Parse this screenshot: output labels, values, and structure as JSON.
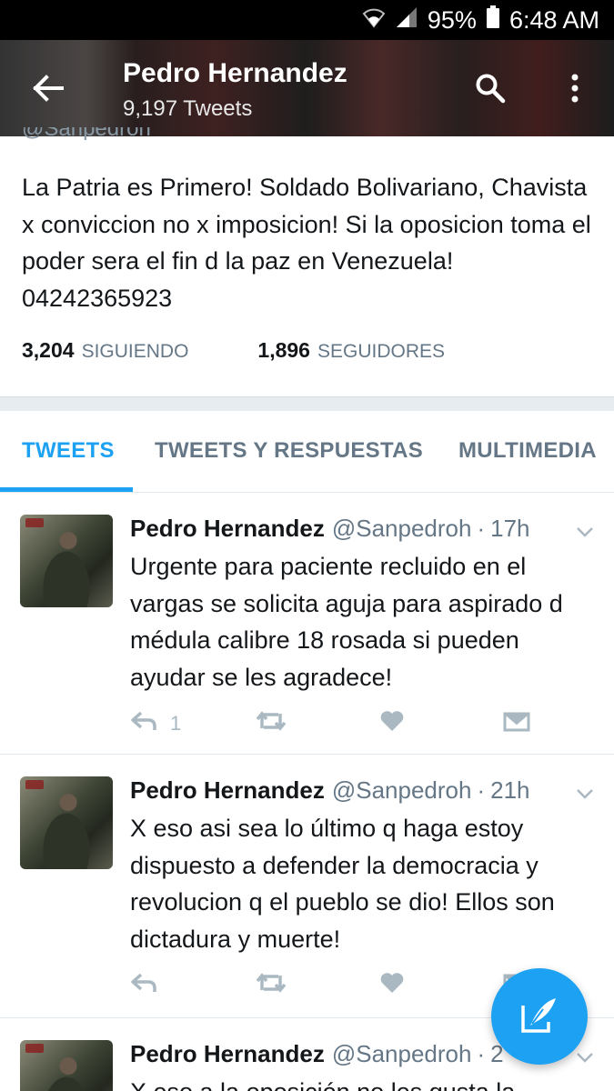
{
  "status_bar": {
    "battery": "95%",
    "time": "6:48 AM",
    "icons": [
      "wifi-icon",
      "signal-icon",
      "battery-icon"
    ]
  },
  "header": {
    "name": "Pedro Hernandez",
    "tweet_count": "9,197 Tweets",
    "icons": [
      "back-arrow-icon",
      "search-icon",
      "more-vertical-icon"
    ]
  },
  "profile": {
    "handle": "@Sanpedroh",
    "bio": "La Patria es Primero! Soldado Bolivariano, Chavista x conviccion no x imposicion! Si la oposicion toma el poder sera el fin d la paz en Venezuela! 04242365923",
    "following_count": "3,204",
    "following_label": "SIGUIENDO",
    "followers_count": "1,896",
    "followers_label": "SEGUIDORES"
  },
  "tabs": [
    {
      "label": "TWEETS",
      "active": true
    },
    {
      "label": "TWEETS Y RESPUESTAS",
      "active": false
    },
    {
      "label": "MULTIMEDIA",
      "active": false
    }
  ],
  "tweets": [
    {
      "name": "Pedro Hernandez",
      "handle": "@Sanpedroh",
      "dot": "·",
      "time": "17h",
      "text": "Urgente para paciente recluido en el vargas se solicita aguja para aspirado d médula calibre 18 rosada si pueden ayudar se les agradece!",
      "reply_count": "1"
    },
    {
      "name": "Pedro Hernandez",
      "handle": "@Sanpedroh",
      "dot": "·",
      "time": "21h",
      "text": "X eso asi sea lo último q haga estoy dispuesto a defender la democracia y revolucion q el pueblo se dio! Ellos son dictadura y muerte!",
      "reply_count": ""
    },
    {
      "name": "Pedro Hernandez",
      "handle": "@Sanpedroh",
      "dot": "·",
      "time": "2",
      "text": "X eso a la oposición no les gusta la",
      "reply_count": ""
    }
  ],
  "colors": {
    "accent": "#1da1f2",
    "muted": "#657786",
    "icon_gray": "#aab8c2"
  },
  "fab": {
    "icon": "compose-tweet-icon"
  }
}
